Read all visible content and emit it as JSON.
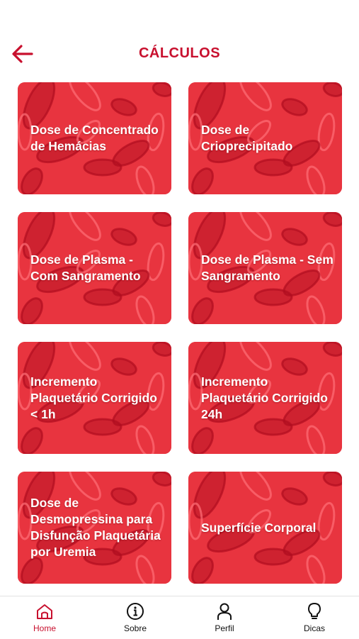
{
  "header": {
    "title": "CÁLCULOS",
    "back_icon": "arrow-left-icon",
    "accent_color": "#c8102e"
  },
  "cards": [
    {
      "id": "hemacias",
      "label": "Dose de Concentrado de Hemácias"
    },
    {
      "id": "crioprecipitado",
      "label": "Dose de Crioprecipitado"
    },
    {
      "id": "plasma-com",
      "label": "Dose de Plasma - Com Sangramento"
    },
    {
      "id": "plasma-sem",
      "label": "Dose de Plasma - Sem Sangramento"
    },
    {
      "id": "incremento-1h",
      "label": "Incremento Plaquetário Corrigido < 1h"
    },
    {
      "id": "incremento-24h",
      "label": "Incremento Plaquetário Corrigido 24h"
    },
    {
      "id": "desmopressina",
      "label": "Dose de Desmopressina para Disfunção Plaquetária por Uremia"
    },
    {
      "id": "superficie",
      "label": "Superfície Corporal"
    }
  ],
  "card_colors": {
    "base": "#e8343f",
    "cell_dark": "#b00d1f",
    "cell_light": "#ff6f77"
  },
  "tabbar": {
    "active_color": "#c8102e",
    "items": [
      {
        "label": "Home",
        "icon": "home-icon",
        "active": true
      },
      {
        "label": "Sobre",
        "icon": "info-icon",
        "active": false
      },
      {
        "label": "Perfil",
        "icon": "user-icon",
        "active": false
      },
      {
        "label": "Dicas",
        "icon": "lightbulb-icon",
        "active": false
      }
    ]
  }
}
